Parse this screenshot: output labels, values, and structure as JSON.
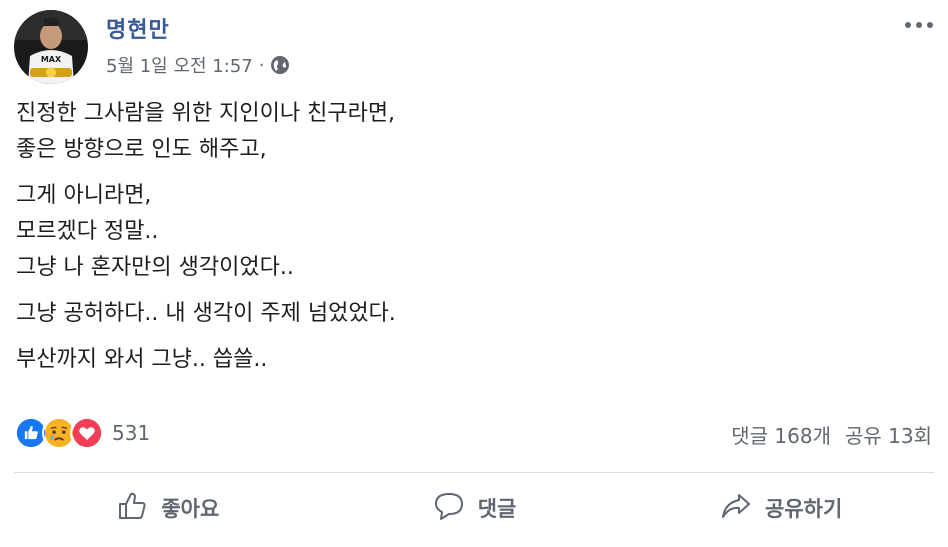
{
  "post": {
    "author": "명현만",
    "timestamp": "5월 1일 오전 1:57",
    "separator": "·",
    "privacy_icon": "globe-icon",
    "more_icon": "ellipsis-icon",
    "paragraphs": [
      [
        "진정한 그사람을 위한 지인이나 친구라면,",
        "좋은 방향으로 인도 해주고,"
      ],
      [
        "그게 아니라면,",
        "모르겠다 정말..",
        "그냥 나 혼자만의 생각이었다.."
      ],
      [
        "그냥 공허하다.. 내 생각이 주제 넘었었다."
      ],
      [
        "부산까지 와서 그냥.. 씁쓸.."
      ]
    ]
  },
  "reactions": {
    "types": [
      "like-icon",
      "sad-icon",
      "love-icon"
    ],
    "count": "531"
  },
  "stats": {
    "comments": "댓글 168개",
    "shares": "공유 13회"
  },
  "actions": {
    "like_label": "좋아요",
    "comment_label": "댓글",
    "share_label": "공유하기"
  },
  "colors": {
    "author": "#385898",
    "like_blue": "#1877f2",
    "love_red": "#f33e58",
    "sad_yellow": "#f7b125",
    "muted": "#616770"
  }
}
